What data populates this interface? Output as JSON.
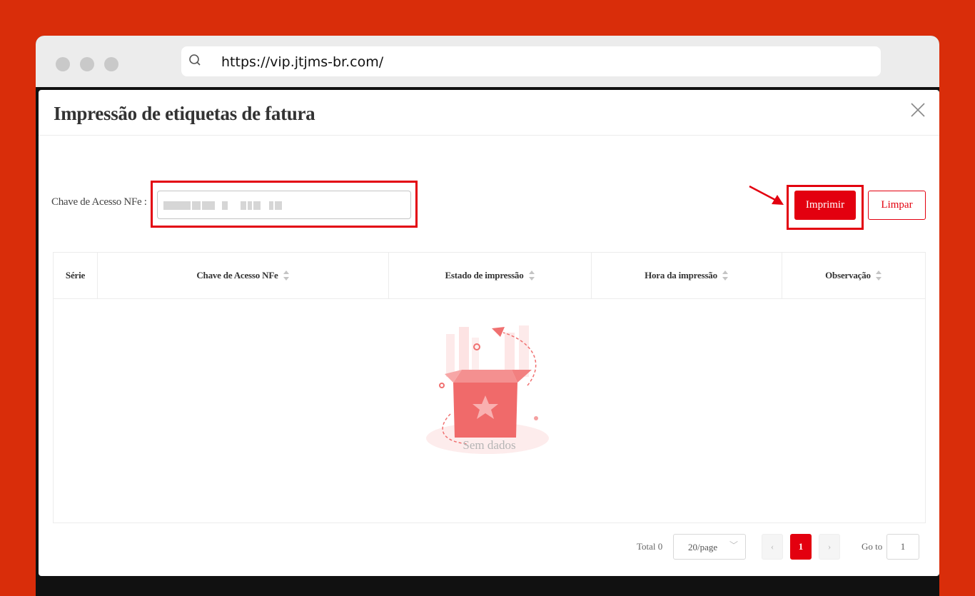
{
  "browser": {
    "url": "https://vip.jtjms-br.com/"
  },
  "modal": {
    "title": "Impressão de etiquetas de fatura"
  },
  "form": {
    "label": "Chave de Acesso NFe :",
    "print_button": "Imprimir",
    "clear_button": "Limpar"
  },
  "table": {
    "columns": [
      {
        "label": "Série",
        "sortable": false
      },
      {
        "label": "Chave de Acesso NFe",
        "sortable": true
      },
      {
        "label": "Estado de impressão",
        "sortable": true
      },
      {
        "label": "Hora da impressão",
        "sortable": true
      },
      {
        "label": "Observação",
        "sortable": true
      }
    ],
    "empty_text": "Sem dados"
  },
  "pagination": {
    "total": "Total 0",
    "page_size": "20/page",
    "current_page": "1",
    "goto_label": "Go to",
    "goto_value": "1"
  },
  "colors": {
    "background": "#d92d0a",
    "accent": "#e3000f"
  }
}
